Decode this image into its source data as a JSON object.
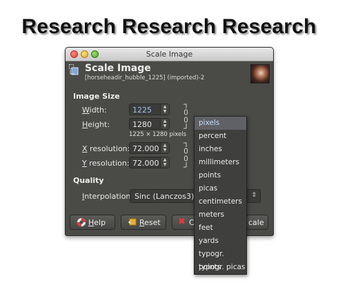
{
  "headline": "Research Research Research",
  "window": {
    "title": "Scale Image",
    "header_title": "Scale Image",
    "header_subtitle": "[horseheadir_hubble_1225] (imported)-2"
  },
  "image_size": {
    "section_label": "Image Size",
    "width_label_u": "W",
    "width_label_rest": "idth:",
    "height_label_u": "H",
    "height_label_rest": "eight:",
    "width_value": "1225",
    "height_value": "1280",
    "dimensions_note": "1225 × 1280 pixels",
    "xres_label_u": "X",
    "xres_label_rest": " resolution:",
    "yres_label_u": "Y",
    "yres_label_rest": " resolution:",
    "xres_value": "72.000",
    "yres_value": "72.000"
  },
  "quality": {
    "section_label": "Quality",
    "interp_label_u": "I",
    "interp_label_rest": "nterpolation:",
    "interp_value": "Sinc (Lanczos3)"
  },
  "buttons": {
    "help_u": "H",
    "help_rest": "elp",
    "reset_u": "R",
    "reset_rest": "eset",
    "cancel_partial": "C",
    "scale_partial": "cale"
  },
  "units_menu": {
    "selected": "pixels",
    "items": [
      "pixels",
      "percent",
      "inches",
      "millimeters",
      "points",
      "picas",
      "centimeters",
      "meters",
      "feet",
      "yards",
      "typogr. points",
      "typogr. picas"
    ]
  },
  "colors": {
    "dialog_bg": "#4a4b47",
    "selected_item_bg": "#5f6166",
    "active_value": "#9cc0ea"
  }
}
